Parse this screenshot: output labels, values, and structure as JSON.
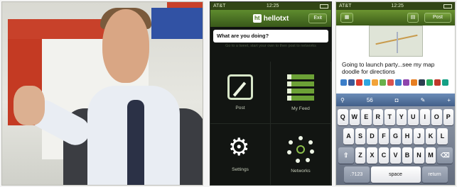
{
  "phone_left": {
    "status_bar": {
      "carrier": "AT&T",
      "time": "12:25"
    },
    "app_name": "hellotxt",
    "exit_button": "Exit",
    "compose": {
      "title": "What are you doing?",
      "hint": "Go to a tweet, start your own to then post to networks"
    },
    "tiles": [
      {
        "label": "Post",
        "icon": "post-icon"
      },
      {
        "label": "My Feed",
        "icon": "feed-icon"
      },
      {
        "label": "Settings",
        "icon": "gear-icon"
      },
      {
        "label": "Networks",
        "icon": "networks-icon"
      }
    ]
  },
  "phone_right": {
    "status_bar": {
      "carrier": "AT&T",
      "time": "12:25"
    },
    "post_button": "Post",
    "message": "Going to launch party...see my map doodle for directions",
    "char_count": "56",
    "keyboard": {
      "row1": [
        "Q",
        "W",
        "E",
        "R",
        "T",
        "Y",
        "U",
        "I",
        "O",
        "P"
      ],
      "row2": [
        "A",
        "S",
        "D",
        "F",
        "G",
        "H",
        "J",
        "K",
        "L"
      ],
      "row3": [
        "Z",
        "X",
        "C",
        "V",
        "B",
        "N",
        "M"
      ],
      "numbers_key": ".?123",
      "space_key": "space",
      "return_key": "return"
    },
    "colors": {
      "navbar": "#4f7625",
      "toolbar": "#5574a1",
      "keyboard": "#7a8394"
    }
  }
}
